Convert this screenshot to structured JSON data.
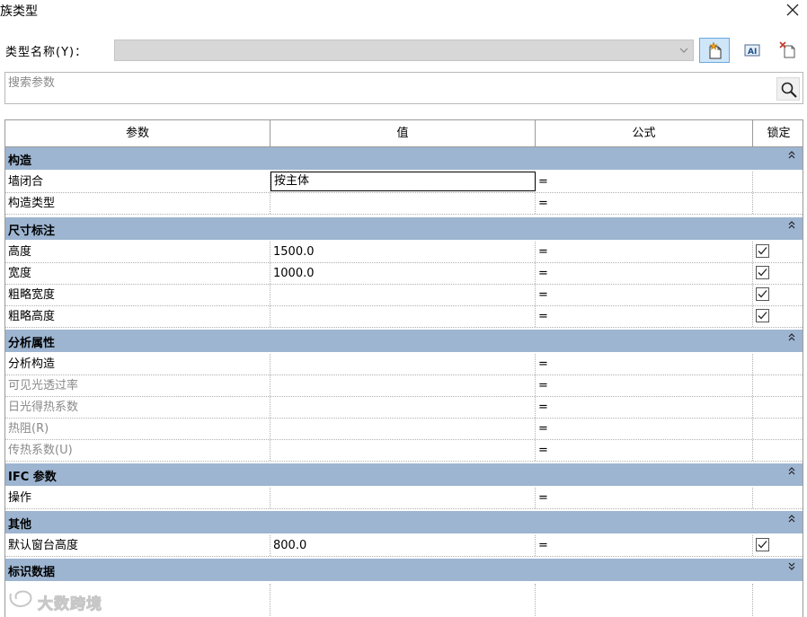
{
  "window": {
    "title": "族类型"
  },
  "type_name": {
    "label": "类型名称(Y)：",
    "value": ""
  },
  "search": {
    "placeholder": "搜索参数"
  },
  "columns": {
    "param": "参数",
    "value": "值",
    "formula": "公式",
    "lock": "锁定"
  },
  "groups": [
    {
      "label": "构造",
      "expanded": true,
      "rows": [
        {
          "name": "墙闭合",
          "value": "按主体",
          "formula": "=",
          "lock": null,
          "editing": true
        },
        {
          "name": "构造类型",
          "value": "",
          "formula": "=",
          "lock": null
        }
      ]
    },
    {
      "label": "尺寸标注",
      "expanded": true,
      "rows": [
        {
          "name": "高度",
          "value": "1500.0",
          "formula": "=",
          "lock": true
        },
        {
          "name": "宽度",
          "value": "1000.0",
          "formula": "=",
          "lock": true
        },
        {
          "name": "粗略宽度",
          "value": "",
          "formula": "=",
          "lock": true
        },
        {
          "name": "粗略高度",
          "value": "",
          "formula": "=",
          "lock": true
        }
      ]
    },
    {
      "label": "分析属性",
      "expanded": true,
      "rows": [
        {
          "name": "分析构造",
          "value": "",
          "formula": "=",
          "lock": null
        },
        {
          "name": "可见光透过率",
          "value": "",
          "formula": "=",
          "lock": null,
          "muted": true
        },
        {
          "name": "日光得热系数",
          "value": "",
          "formula": "=",
          "lock": null,
          "muted": true
        },
        {
          "name": "热阻(R)",
          "value": "",
          "formula": "=",
          "lock": null,
          "muted": true
        },
        {
          "name": "传热系数(U)",
          "value": "",
          "formula": "=",
          "lock": null,
          "muted": true
        }
      ]
    },
    {
      "label": "IFC 参数",
      "expanded": true,
      "rows": [
        {
          "name": "操作",
          "value": "",
          "formula": "=",
          "lock": null
        }
      ]
    },
    {
      "label": "其他",
      "expanded": true,
      "rows": [
        {
          "name": "默认窗台高度",
          "value": "800.0",
          "formula": "=",
          "lock": true
        }
      ]
    },
    {
      "label": "标识数据",
      "expanded": false,
      "rows": []
    }
  ],
  "watermark": {
    "text": "大数跨境"
  },
  "colors": {
    "group_header": "#9db5d1",
    "active_button": "#cfe5f8"
  }
}
